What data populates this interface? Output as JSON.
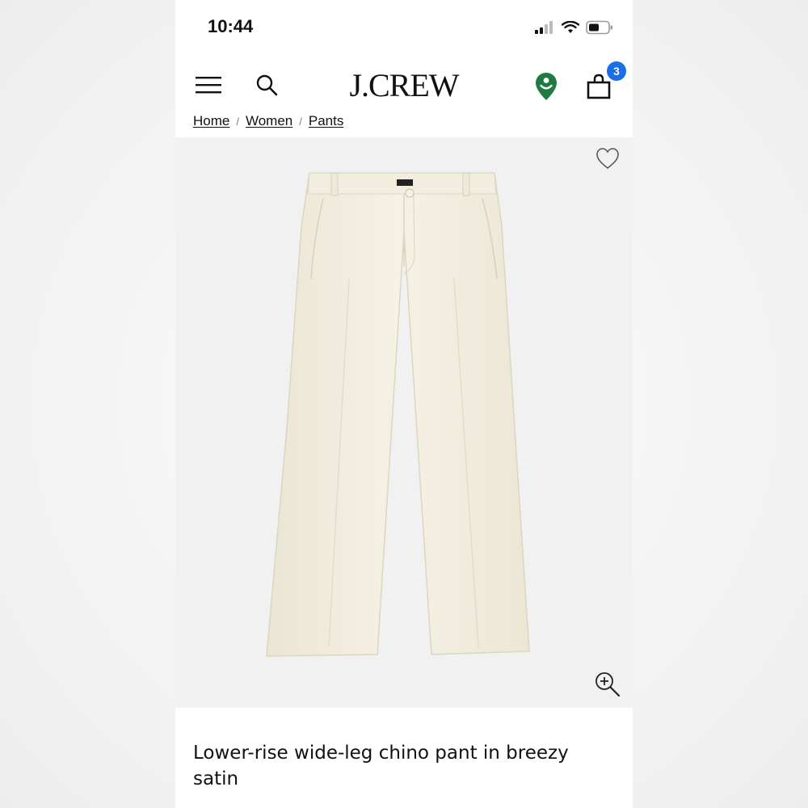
{
  "status_bar": {
    "time": "10:44"
  },
  "header": {
    "logo": "J.CREW",
    "bag_count": "3"
  },
  "breadcrumb": [
    "Home",
    "Women",
    "Pants"
  ],
  "product": {
    "title": "Lower-rise wide-leg chino pant in breezy satin"
  },
  "icons": [
    "menu-icon",
    "search-icon",
    "store-locator-icon",
    "shopping-bag-icon",
    "heart-icon",
    "zoom-icon"
  ],
  "colors": {
    "badge": "#1a6ee6",
    "store_pin": "#1e7a3e",
    "pant": "#f3eedf"
  }
}
